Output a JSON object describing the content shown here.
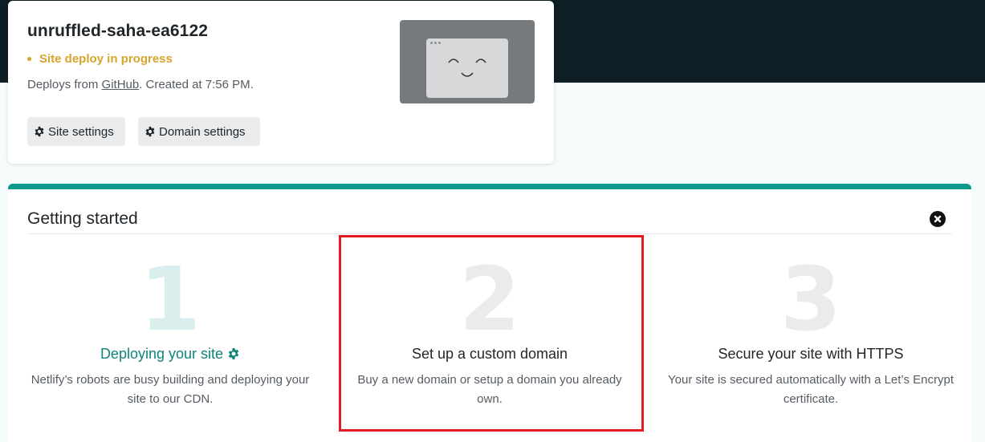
{
  "site": {
    "name": "unruffled-saha-ea6122",
    "status": "Site deploy in progress",
    "deploy_prefix": "Deploys from ",
    "deploy_source": "GitHub",
    "deploy_suffix": ". Created at 7:56 PM.",
    "buttons": {
      "site_settings": "Site settings",
      "domain_settings": "Domain settings"
    }
  },
  "getting_started": {
    "title": "Getting started",
    "steps": [
      {
        "number": "1",
        "title": "Deploying your site",
        "description": "Netlify’s robots are busy building and deploying your site to our CDN."
      },
      {
        "number": "2",
        "title": "Set up a custom domain",
        "description": "Buy a new domain or setup a domain you already own."
      },
      {
        "number": "3",
        "title": "Secure your site with HTTPS",
        "description": "Your site is secured automatically with a Let’s Encrypt certificate."
      }
    ]
  },
  "colors": {
    "accent": "#0a9a8c",
    "status": "#d8a42c",
    "highlight": "#e31b23",
    "header_band": "#0e1e25"
  },
  "icons": {
    "settings": "gear-icon",
    "close": "close-icon"
  }
}
